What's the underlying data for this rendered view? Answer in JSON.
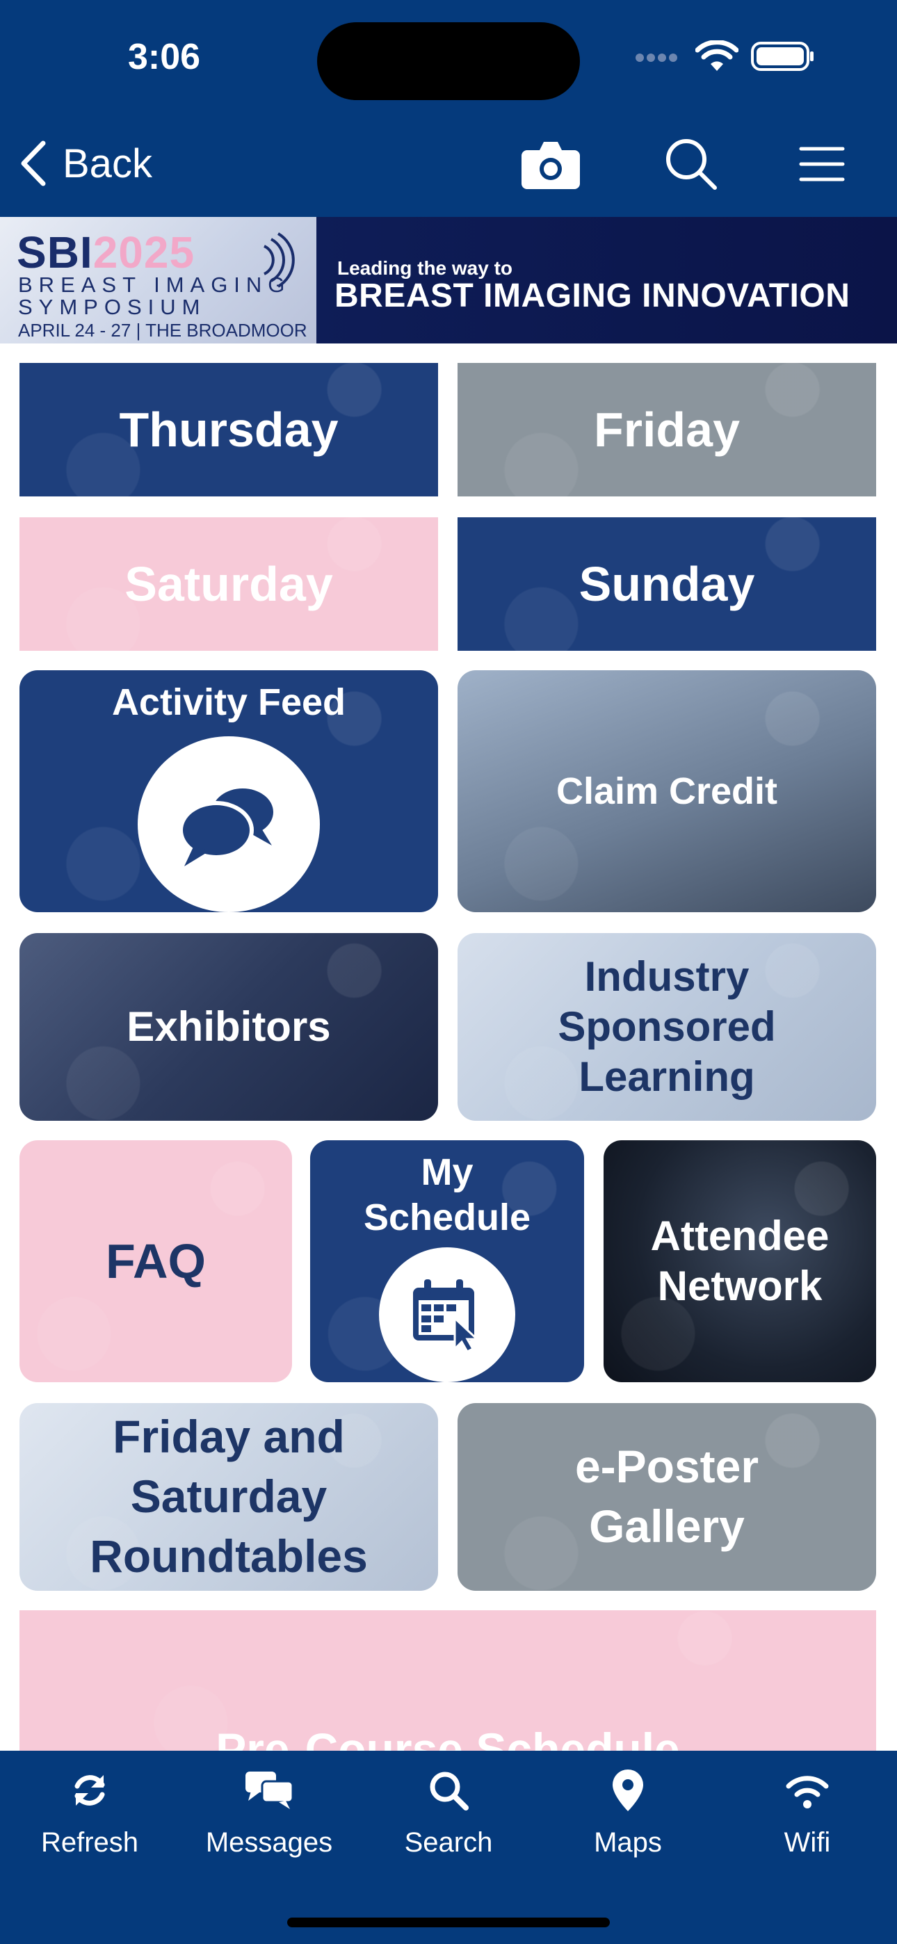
{
  "status_bar": {
    "time": "3:06"
  },
  "nav": {
    "back_label": "Back"
  },
  "banner": {
    "logo_sbi": "SBI",
    "logo_year": "2025",
    "line1": "BREAST IMAGING",
    "line2": "SYMPOSIUM",
    "date_venue": "APRIL 24 - 27 | THE BROADMOOR",
    "tagline_small": "Leading the way to",
    "tagline_large": "BREAST IMAGING INNOVATION"
  },
  "tiles": {
    "thursday": "Thursday",
    "friday": "Friday",
    "saturday": "Saturday",
    "sunday": "Sunday",
    "activity_feed": "Activity Feed",
    "claim_credit": "Claim Credit",
    "exhibitors": "Exhibitors",
    "industry": "Industry Sponsored Learning",
    "faq": "FAQ",
    "my_schedule": "My Schedule",
    "attendee_network": "Attendee Network",
    "roundtables": "Friday and Saturday Roundtables",
    "eposter": "e-Poster Gallery",
    "precourse": "Pre-Course Schedule"
  },
  "tabbar": {
    "refresh": "Refresh",
    "messages": "Messages",
    "search": "Search",
    "maps": "Maps",
    "wifi": "Wifi"
  },
  "colors": {
    "header_blue": "#053a7c",
    "tile_navy": "#1e3f7c",
    "tile_gray": "#8b959d",
    "tile_pink": "#f7cad8"
  }
}
